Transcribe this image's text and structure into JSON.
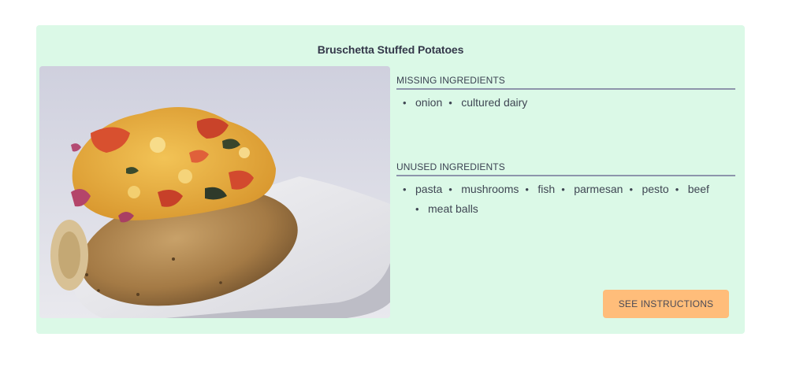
{
  "recipe": {
    "title": "Bruschetta Stuffed Potatoes",
    "image_alt": "stuffed potato icon"
  },
  "missing": {
    "heading": "MISSING INGREDIENTS",
    "items": [
      "onion",
      "cultured dairy"
    ]
  },
  "unused": {
    "heading": "UNUSED INGREDIENTS",
    "items": [
      "pasta",
      "mushrooms",
      "fish",
      "parmesan",
      "pesto",
      "beef",
      "meat balls"
    ]
  },
  "actions": {
    "instructions_label": "SEE INSTRUCTIONS"
  },
  "colors": {
    "card_background": "#dbf9e7",
    "button_background": "#ffbd7a",
    "divider": "#8d95ab",
    "text": "#3f4653"
  }
}
